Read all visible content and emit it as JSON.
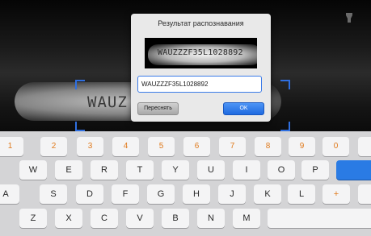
{
  "camera": {
    "background_vin": "WAUZ"
  },
  "dialog": {
    "title": "Результат распознавания",
    "preview_text": "WAUZZZF35L1028892",
    "input_value": "WAUZZZF35L1028892",
    "retry_label": "Переснять",
    "ok_label": "OK"
  },
  "keyboard": {
    "row1": [
      "1",
      "2",
      "3",
      "4",
      "5",
      "6",
      "7",
      "8",
      "9",
      "0"
    ],
    "row2": [
      "W",
      "E",
      "R",
      "T",
      "Y",
      "U",
      "I",
      "O",
      "P"
    ],
    "row3": [
      "A",
      "S",
      "D",
      "F",
      "G",
      "H",
      "J",
      "K",
      "L",
      "+"
    ],
    "row4": [
      "Z",
      "X",
      "C",
      "V",
      "B",
      "N",
      "M"
    ]
  },
  "colors": {
    "accent": "#2a7be4",
    "number_key_text": "#e07a1c",
    "dialog_bg": "#e9e9e9",
    "keyboard_bg": "#d4d4d6"
  }
}
